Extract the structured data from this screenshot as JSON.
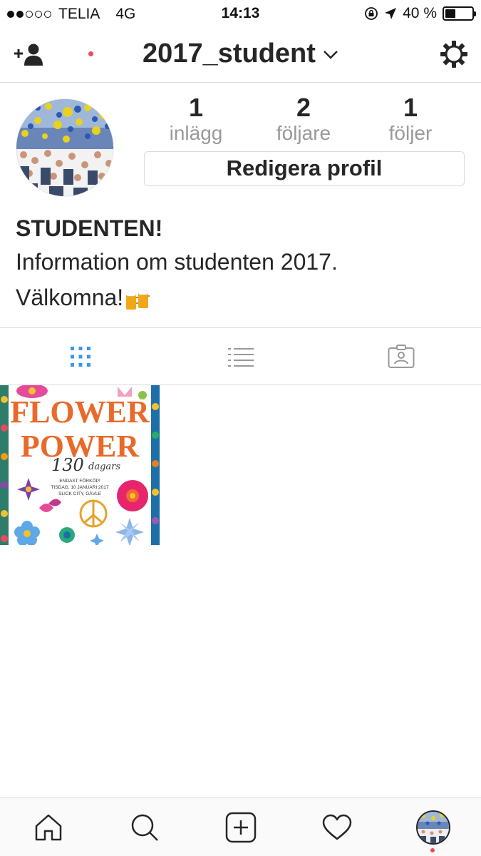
{
  "status_bar": {
    "carrier": "TELIA",
    "network": "4G",
    "time": "14:13",
    "battery_text": "40 %",
    "battery_level": 0.4,
    "signal_bars_filled": 2,
    "signal_bars_total": 5
  },
  "header": {
    "username": "2017_student",
    "icons": [
      "add-user-icon",
      "chevron-down-icon",
      "gear-icon"
    ],
    "notification_dot_color": "#ed4956"
  },
  "profile": {
    "stats": [
      {
        "count": "1",
        "label": "inlägg"
      },
      {
        "count": "2",
        "label": "följare"
      },
      {
        "count": "1",
        "label": "följer"
      }
    ],
    "edit_button": "Redigera profil",
    "bio_name": "STUDENTEN!",
    "bio_line1": "Information om studenten 2017.",
    "bio_line2": "Välkomna!",
    "bio_emoji": "beer-mugs-emoji"
  },
  "tabs": [
    {
      "name": "grid",
      "icon": "grid-icon",
      "active": true
    },
    {
      "name": "list",
      "icon": "list-icon",
      "active": false
    },
    {
      "name": "tagged",
      "icon": "tagged-person-icon",
      "active": false
    }
  ],
  "posts": [
    {
      "title_line1": "FLOWER",
      "title_line2": "POWER",
      "subtitle_num": "130",
      "subtitle_word": "dagars",
      "info_line1": "ENDAST FÖRKÖP!",
      "info_line2": "TISDAG, 10 JANUARI 2017",
      "info_line3": "SLICK CITY, GÄVLE"
    }
  ],
  "bottom_nav": [
    {
      "name": "home",
      "icon": "home-icon"
    },
    {
      "name": "search",
      "icon": "search-icon"
    },
    {
      "name": "add",
      "icon": "add-post-icon"
    },
    {
      "name": "activity",
      "icon": "heart-icon"
    },
    {
      "name": "profile",
      "icon": "profile-avatar"
    }
  ],
  "colors": {
    "accent": "#3897f0",
    "text": "#262626",
    "muted": "#999999",
    "border": "#dbdbdb"
  }
}
